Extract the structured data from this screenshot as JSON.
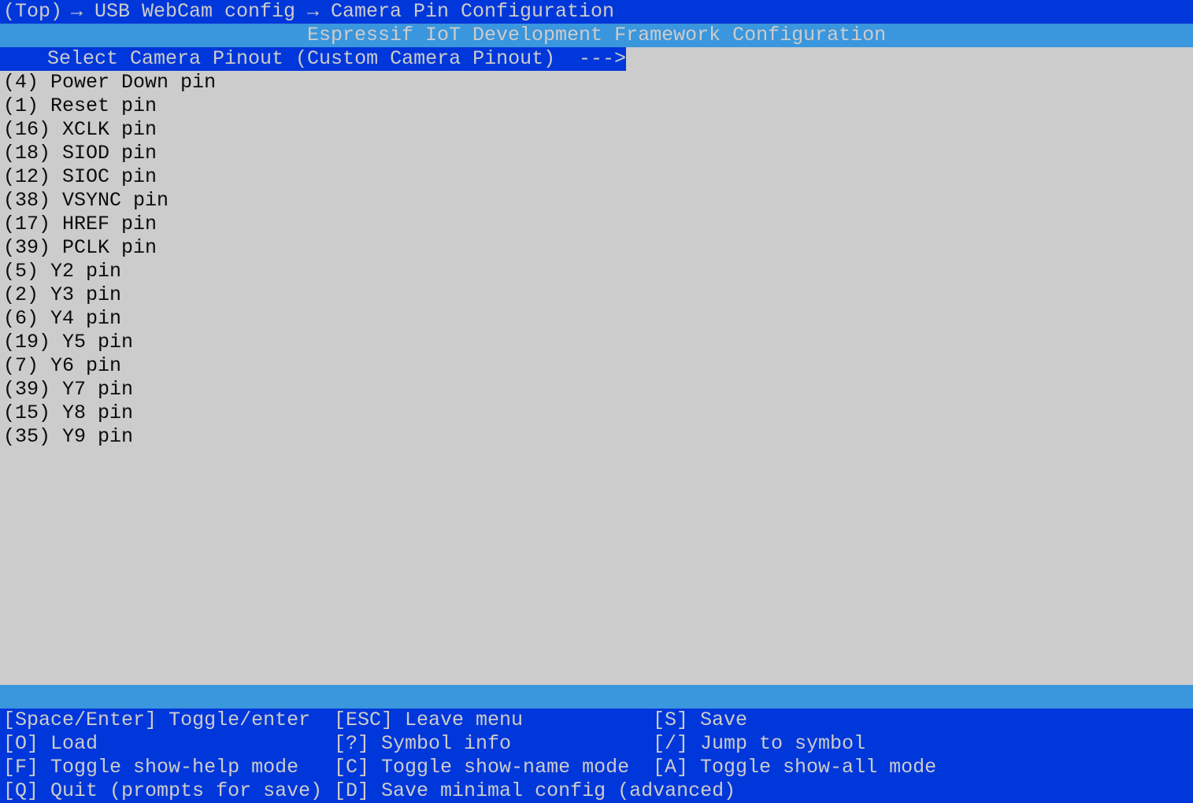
{
  "breadcrumb": [
    "(Top)",
    "USB WebCam config",
    "Camera Pin Configuration"
  ],
  "breadcrumb_separator": "→",
  "title": "Espressif IoT Development Framework Configuration",
  "selected_item": {
    "label": "Select Camera Pinout (Custom Camera Pinout)",
    "suffix": "--->"
  },
  "items": [
    {
      "value": "(4)",
      "label": "Power Down pin"
    },
    {
      "value": "(1)",
      "label": "Reset pin"
    },
    {
      "value": "(16)",
      "label": "XCLK pin"
    },
    {
      "value": "(18)",
      "label": "SIOD pin"
    },
    {
      "value": "(12)",
      "label": "SIOC pin"
    },
    {
      "value": "(38)",
      "label": "VSYNC pin"
    },
    {
      "value": "(17)",
      "label": "HREF pin"
    },
    {
      "value": "(39)",
      "label": "PCLK pin"
    },
    {
      "value": "(5)",
      "label": "Y2 pin"
    },
    {
      "value": "(2)",
      "label": "Y3 pin"
    },
    {
      "value": "(6)",
      "label": "Y4 pin"
    },
    {
      "value": "(19)",
      "label": "Y5 pin"
    },
    {
      "value": "(7)",
      "label": "Y6 pin"
    },
    {
      "value": "(39)",
      "label": "Y7 pin"
    },
    {
      "value": "(15)",
      "label": "Y8 pin"
    },
    {
      "value": "(35)",
      "label": "Y9 pin"
    }
  ],
  "shortcuts": [
    [
      {
        "key": "[Space/Enter]",
        "label": "Toggle/enter"
      },
      {
        "key": "[ESC]",
        "label": "Leave menu"
      },
      {
        "key": "[S]",
        "label": "Save"
      }
    ],
    [
      {
        "key": "[O]",
        "label": "Load"
      },
      {
        "key": "[?]",
        "label": "Symbol info"
      },
      {
        "key": "[/]",
        "label": "Jump to symbol"
      }
    ],
    [
      {
        "key": "[F]",
        "label": "Toggle show-help mode"
      },
      {
        "key": "[C]",
        "label": "Toggle show-name mode"
      },
      {
        "key": "[A]",
        "label": "Toggle show-all mode"
      }
    ],
    [
      {
        "key": "[Q]",
        "label": "Quit (prompts for save)"
      },
      {
        "key": "[D]",
        "label": "Save minimal config (advanced)"
      },
      null
    ]
  ],
  "colors": {
    "dark_blue": "#0037da",
    "light_blue": "#3a96dd",
    "background": "#cccccc",
    "text": "#0c0c0c"
  }
}
